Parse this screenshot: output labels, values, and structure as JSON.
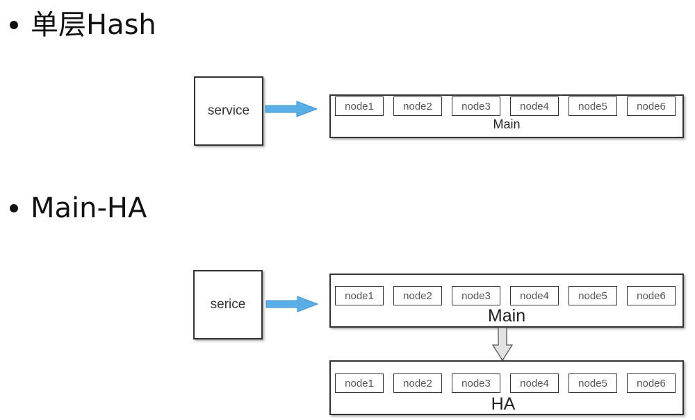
{
  "sections": [
    {
      "heading": "单层Hash",
      "service_label": "service",
      "clusters": [
        {
          "label": "Main",
          "nodes": [
            "node1",
            "node2",
            "node3",
            "node4",
            "node5",
            "node6"
          ]
        }
      ]
    },
    {
      "heading": "Main-HA",
      "service_label": "serice",
      "clusters": [
        {
          "label": "Main",
          "nodes": [
            "node1",
            "node2",
            "node3",
            "node4",
            "node5",
            "node6"
          ]
        },
        {
          "label": "HA",
          "nodes": [
            "node1",
            "node2",
            "node3",
            "node4",
            "node5",
            "node6"
          ]
        }
      ]
    }
  ],
  "colors": {
    "flow_arrow": "#5aaee6",
    "replication_arrow": "#e0e0e0",
    "border": "#333333"
  }
}
